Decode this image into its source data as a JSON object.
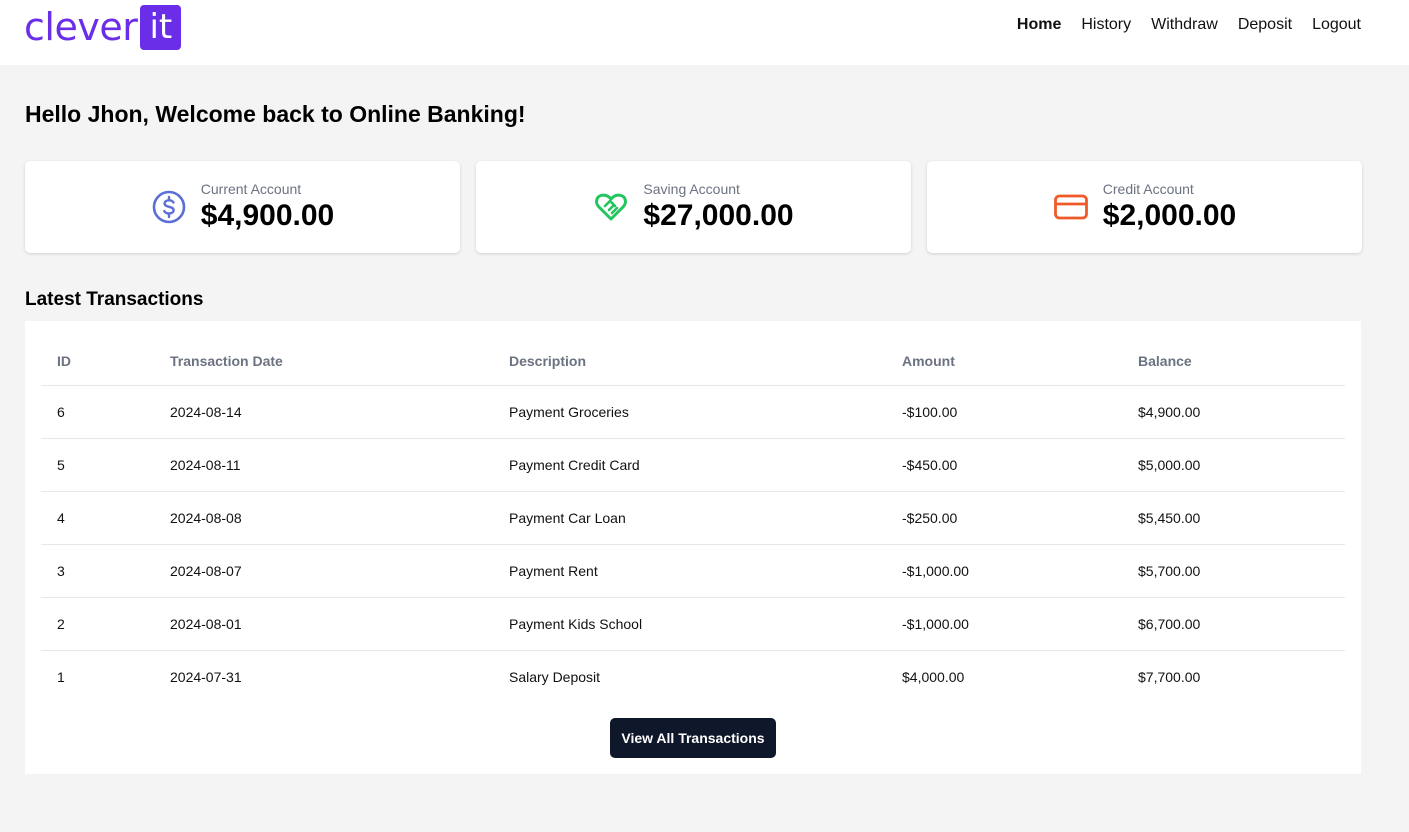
{
  "brand": {
    "word": "clever",
    "box": "it",
    "color": "#6a2ee8"
  },
  "nav": [
    {
      "label": "Home",
      "active": true
    },
    {
      "label": "History",
      "active": false
    },
    {
      "label": "Withdraw",
      "active": false
    },
    {
      "label": "Deposit",
      "active": false
    },
    {
      "label": "Logout",
      "active": false
    }
  ],
  "greeting": "Hello Jhon, Welcome back to Online Banking!",
  "accounts": [
    {
      "label": "Current Account",
      "amount": "$4,900.00",
      "icon": "dollar-circle-icon",
      "color": "#5b6fd6"
    },
    {
      "label": "Saving Account",
      "amount": "$27,000.00",
      "icon": "heart-handshake-icon",
      "color": "#22c55e"
    },
    {
      "label": "Credit Account",
      "amount": "$2,000.00",
      "icon": "credit-card-icon",
      "color": "#f05a28"
    }
  ],
  "transactions": {
    "title": "Latest Transactions",
    "columns": [
      "ID",
      "Transaction Date",
      "Description",
      "Amount",
      "Balance"
    ],
    "rows": [
      {
        "id": "6",
        "date": "2024-08-14",
        "description": "Payment Groceries",
        "amount": "-$100.00",
        "balance": "$4,900.00"
      },
      {
        "id": "5",
        "date": "2024-08-11",
        "description": "Payment Credit Card",
        "amount": "-$450.00",
        "balance": "$5,000.00"
      },
      {
        "id": "4",
        "date": "2024-08-08",
        "description": "Payment Car Loan",
        "amount": "-$250.00",
        "balance": "$5,450.00"
      },
      {
        "id": "3",
        "date": "2024-08-07",
        "description": "Payment Rent",
        "amount": "-$1,000.00",
        "balance": "$5,700.00"
      },
      {
        "id": "2",
        "date": "2024-08-01",
        "description": "Payment Kids School",
        "amount": "-$1,000.00",
        "balance": "$6,700.00"
      },
      {
        "id": "1",
        "date": "2024-07-31",
        "description": "Salary Deposit",
        "amount": "$4,000.00",
        "balance": "$7,700.00"
      }
    ],
    "view_all_label": "View All Transactions"
  }
}
